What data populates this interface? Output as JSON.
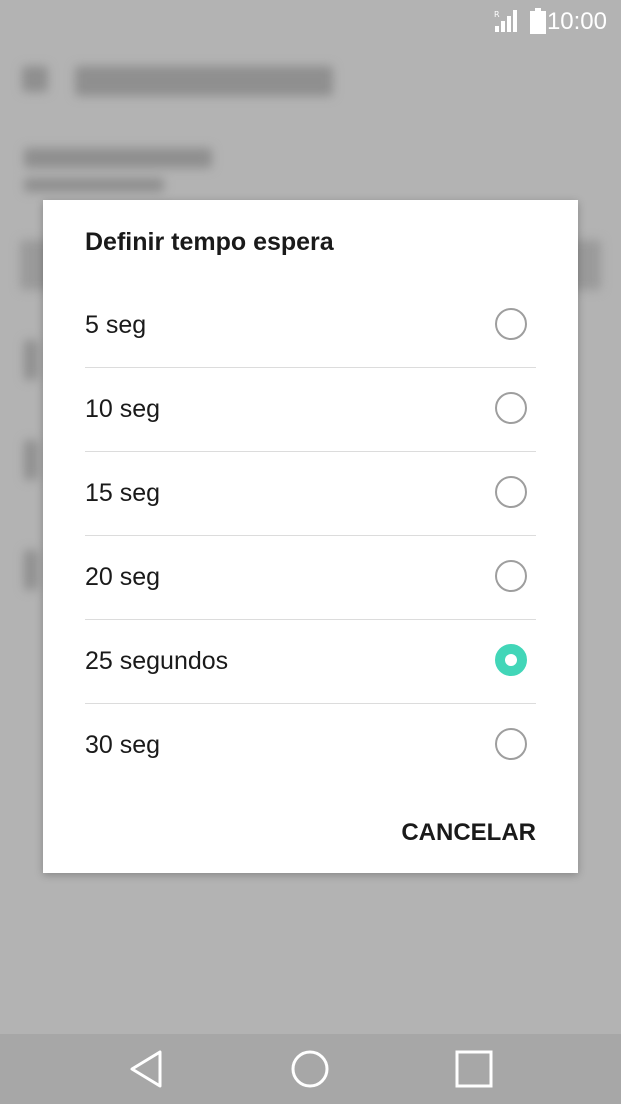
{
  "status_bar": {
    "time": "10:00",
    "signal_icon": "signal-icon",
    "battery_icon": "battery-icon"
  },
  "dialog": {
    "title": "Definir tempo espera",
    "options": [
      {
        "label": "5 seg",
        "selected": false
      },
      {
        "label": "10 seg",
        "selected": false
      },
      {
        "label": "15 seg",
        "selected": false
      },
      {
        "label": "20 seg",
        "selected": false
      },
      {
        "label": "25 segundos",
        "selected": true
      },
      {
        "label": "30 seg",
        "selected": false
      }
    ],
    "cancel_label": "CANCELAR"
  },
  "nav_bar": {
    "back_icon": "back-icon",
    "home_icon": "home-icon",
    "recents_icon": "recents-icon"
  },
  "colors": {
    "accent": "#42d6b8",
    "overlay": "#b3b3b3"
  }
}
